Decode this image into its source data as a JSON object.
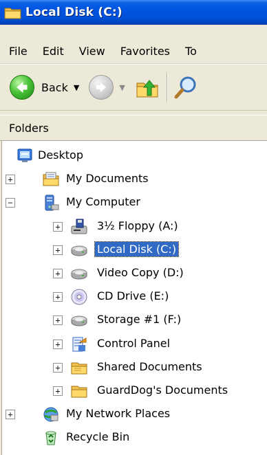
{
  "window": {
    "title": "Local Disk (C:)"
  },
  "menu": [
    "File",
    "Edit",
    "View",
    "Favorites",
    "To"
  ],
  "toolbar": {
    "back_label": "Back"
  },
  "folders": {
    "header": "Folders"
  },
  "tree": [
    {
      "label": "Desktop",
      "icon": "desktop-icon",
      "level": 0,
      "expander": ""
    },
    {
      "label": "My Documents",
      "icon": "my-documents-icon",
      "level": 1,
      "expander": "+"
    },
    {
      "label": "My Computer",
      "icon": "my-computer-icon",
      "level": 1,
      "expander": "−"
    },
    {
      "label": "3½ Floppy (A:)",
      "icon": "floppy-drive-icon",
      "level": 2,
      "expander": "+"
    },
    {
      "label": "Local Disk (C:)",
      "icon": "hard-drive-icon",
      "level": 2,
      "expander": "+",
      "selected": true
    },
    {
      "label": "Video Copy (D:)",
      "icon": "hard-drive-icon",
      "level": 2,
      "expander": "+"
    },
    {
      "label": "CD Drive (E:)",
      "icon": "cd-drive-icon",
      "level": 2,
      "expander": "+"
    },
    {
      "label": "Storage #1 (F:)",
      "icon": "hard-drive-icon",
      "level": 2,
      "expander": "+"
    },
    {
      "label": "Control Panel",
      "icon": "control-panel-icon",
      "level": 2,
      "expander": "+"
    },
    {
      "label": "Shared Documents",
      "icon": "shared-folder-icon",
      "level": 2,
      "expander": "+"
    },
    {
      "label": "GuardDog's Documents",
      "icon": "folder-icon",
      "level": 2,
      "expander": "+"
    },
    {
      "label": "My Network Places",
      "icon": "network-places-icon",
      "level": 1,
      "expander": "+"
    },
    {
      "label": "Recycle Bin",
      "icon": "recycle-bin-icon",
      "level": 1,
      "expander": ""
    }
  ]
}
